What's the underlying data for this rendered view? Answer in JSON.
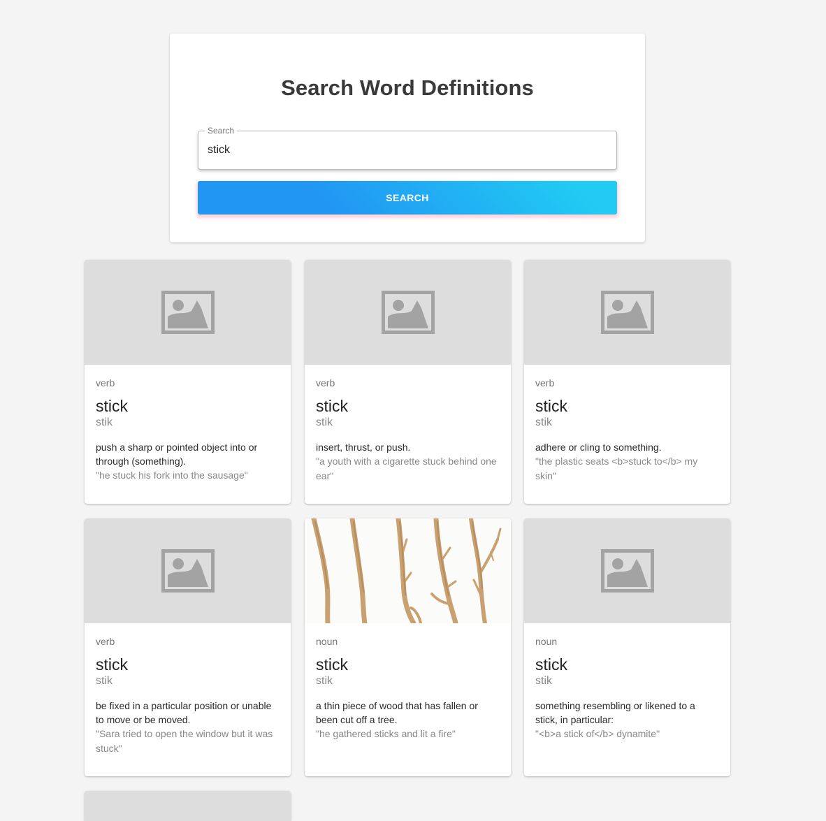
{
  "search": {
    "title": "Search Word Definitions",
    "field_label": "Search",
    "value": "stick",
    "button_label": "Search"
  },
  "colors": {
    "page_background": "#f4f4f4",
    "placeholder_background": "#dddddd",
    "placeholder_icon": "#a3a3a3",
    "button_gradient_start": "#2196f3",
    "button_gradient_end": "#21cbf3"
  },
  "cards": [
    {
      "pos": "verb",
      "word": "stick",
      "phonetic": "stik",
      "definition": "push a sharp or pointed object into or through (something).",
      "example": "\"he stuck his fork into the sausage\"",
      "media": "image-placeholder-icon"
    },
    {
      "pos": "verb",
      "word": "stick",
      "phonetic": "stik",
      "definition": "insert, thrust, or push.",
      "example": "\"a youth with a cigarette stuck behind one ear\"",
      "media": "image-placeholder-icon"
    },
    {
      "pos": "verb",
      "word": "stick",
      "phonetic": "stik",
      "definition": "adhere or cling to something.",
      "example": "\"the plastic seats <b>stuck to</b> my skin\"",
      "media": "image-placeholder-icon"
    },
    {
      "pos": "verb",
      "word": "stick",
      "phonetic": "stik",
      "definition": "be fixed in a particular position or unable to move or be moved.",
      "example": "\"Sara tried to open the window but it was stuck\"",
      "media": "image-placeholder-icon"
    },
    {
      "pos": "noun",
      "word": "stick",
      "phonetic": "stik",
      "definition": "a thin piece of wood that has fallen or been cut off a tree.",
      "example": "\"he gathered sticks and lit a fire\"",
      "media": "wooden-sticks-photo"
    },
    {
      "pos": "noun",
      "word": "stick",
      "phonetic": "stik",
      "definition": "something resembling or likened to a stick, in particular:",
      "example": "\"<b>a stick of</b> dynamite\"",
      "media": "image-placeholder-icon"
    }
  ]
}
